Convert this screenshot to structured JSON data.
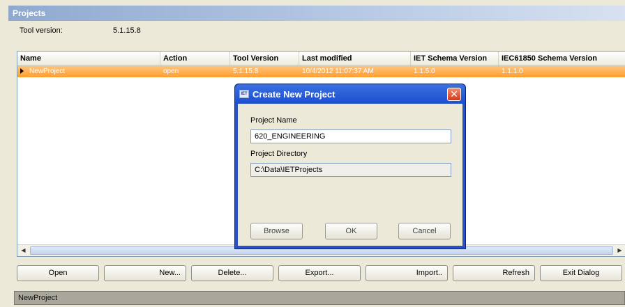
{
  "window": {
    "title": "Projects"
  },
  "tool_version": {
    "label": "Tool version:",
    "value": "5.1.15.8"
  },
  "table": {
    "columns": [
      "Name",
      "Action",
      "Tool Version",
      "Last modified",
      "IET Schema Version",
      "IEC61850 Schema Version"
    ],
    "rows": [
      {
        "name": "NewProject",
        "action": "open",
        "tool_version": "5.1.15.8",
        "last_modified": "10/4/2012 11:07:37 AM",
        "iet_schema": "1.1.5.0",
        "iec_schema": "1.1.1.0"
      }
    ]
  },
  "scroll_arrows": {
    "left": "◀",
    "right": "▶"
  },
  "buttons": {
    "open": "Open",
    "new": "New...",
    "delete": "Delete...",
    "export": "Export...",
    "import": "Import..",
    "refresh": "Refresh",
    "exit": "Exit Dialog"
  },
  "status": {
    "text": "NewProject"
  },
  "dialog": {
    "title": "Create New Project",
    "icon_text": "IET",
    "close": "✕",
    "project_name_label": "Project Name",
    "project_name_value": "620_ENGINEERING",
    "project_dir_label": "Project Directory",
    "project_dir_value": "C:\\Data\\IETProjects",
    "browse": "Browse",
    "ok": "OK",
    "cancel": "Cancel"
  },
  "colors": {
    "selected_row": "#ff9d2e",
    "title_bar": "#2a52c4",
    "close_button": "#d83717"
  },
  "icons": [
    "row-selector-icon",
    "scroll-left-icon",
    "scroll-right-icon",
    "dialog-app-icon",
    "close-icon"
  ]
}
